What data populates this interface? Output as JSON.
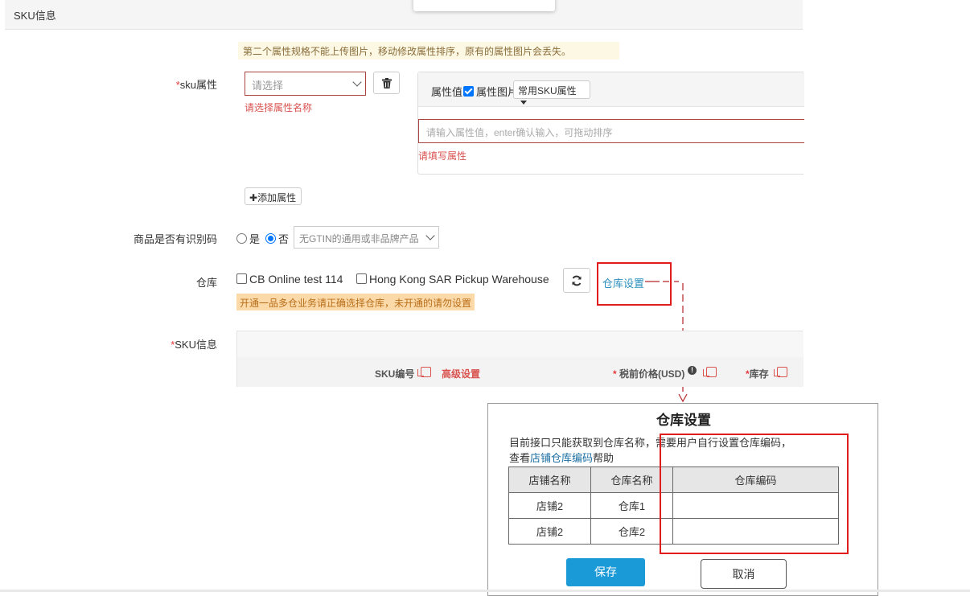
{
  "header": {
    "title": "SKU信息"
  },
  "notice": {
    "pic_warning": "第二个属性规格不能上传图片，移动修改属性排序，原有的属性图片会丢失。"
  },
  "sku_attr": {
    "label": "sku属性",
    "required_mark": "*",
    "select_placeholder": "请选择",
    "select_error": "请选择属性名称",
    "value_header": "属性值",
    "pic_checkbox_label": "属性图片",
    "common_sku_btn": "常用SKU属性",
    "value_input_placeholder": "请输入属性值，enter确认输入，可拖动排序",
    "value_error": "请填写属性",
    "add_btn": "添加属性"
  },
  "identifier": {
    "label": "商品是否有识别码",
    "yes": "是",
    "no": "否",
    "select_value": "无GTIN的通用或非品牌产品"
  },
  "warehouse": {
    "label": "仓库",
    "options": [
      "CB Online test 114",
      "Hong Kong SAR Pickup Warehouse"
    ],
    "settings_link": "仓库设置",
    "warning": "开通一品多仓业务请正确选择仓库，未开通的请勿设置"
  },
  "sku_info": {
    "label": "SKU信息",
    "required_mark": "*",
    "col_sku_code": "SKU编号",
    "col_advanced": "高级设置",
    "col_price": "税前价格(USD)",
    "col_price_mark": "*",
    "col_stock": "库存",
    "col_stock_mark": "*"
  },
  "dialog": {
    "title": "仓库设置",
    "desc_line1": "目前接口只能获取到仓库名称，需要用户自行设置仓库编码，",
    "desc_prefix": "查看",
    "desc_link": "店铺仓库编码",
    "desc_suffix": "帮助",
    "table_headers": [
      "店铺名称",
      "仓库名称",
      "仓库编码"
    ],
    "rows": [
      {
        "shop": "店铺2",
        "warehouse": "仓库1",
        "code": ""
      },
      {
        "shop": "店铺2",
        "warehouse": "仓库2",
        "code": ""
      }
    ],
    "save_btn": "保存",
    "cancel_btn": "取消"
  },
  "colors": {
    "link": "#2a8fbd",
    "primary_btn": "#1a9ad6",
    "error": "#d9534f",
    "highlight_box": "#e01c1c",
    "arrow": "#b5262b"
  }
}
